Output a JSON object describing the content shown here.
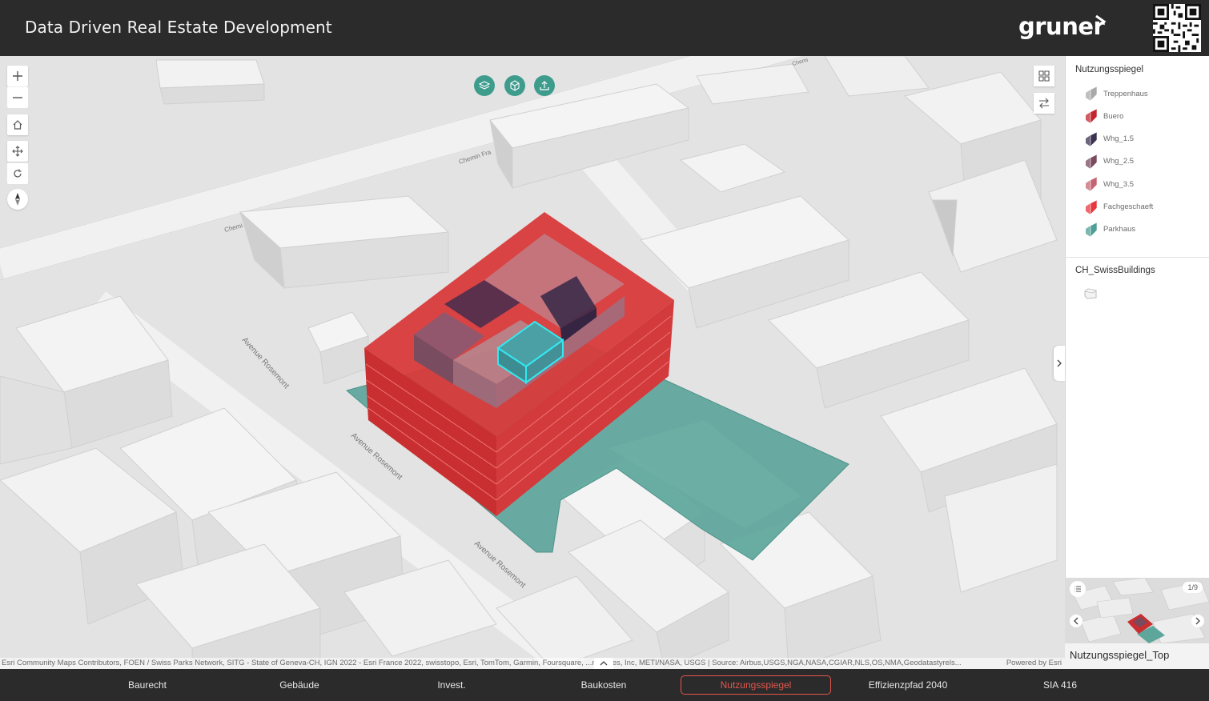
{
  "header": {
    "title": "Data Driven Real Estate Development",
    "logo_text": "gruner"
  },
  "map": {
    "street_labels": [
      "Avenue Rosemont",
      "Avenue Rosemont",
      "Avenue Rosemont",
      "Chemin Fra",
      "Chemi",
      "Chemi"
    ],
    "attribution": "Esri Community Maps Contributors, FOEN / Swiss Parks Network, SITG - State of Geneva-CH, IGN 2022 - Esri France 2022, swisstopo, Esri, TomTom, Garmin, Foursquare, ...nologies, Inc, METI/NASA, USGS | Source: Airbus,USGS,NGA,NASA,CGIAR,NLS,OS,NMA,Geodatastyrels...",
    "powered_by": "Powered by Esri"
  },
  "controls": {
    "zoom_in": "+",
    "zoom_out": "−",
    "top_icons": [
      "layers-icon",
      "basemap-icon",
      "upload-icon"
    ]
  },
  "legend": {
    "title": "Nutzungsspiegel",
    "items": [
      {
        "label": "Treppenhaus",
        "color": "#a9a9a9"
      },
      {
        "label": "Buero",
        "color": "#c1272d"
      },
      {
        "label": "Whg_1.5",
        "color": "#3c3150"
      },
      {
        "label": "Whg_2.5",
        "color": "#7a4a5e"
      },
      {
        "label": "Whg_3.5",
        "color": "#c56470"
      },
      {
        "label": "Fachgeschaeft",
        "color": "#e5383e"
      },
      {
        "label": "Parkhaus",
        "color": "#4f9f95"
      }
    ],
    "layer2_title": "CH_SwissBuildings"
  },
  "slides": {
    "counter": "1/9",
    "label": "Nutzungsspiegel_Top"
  },
  "tabs": [
    {
      "label": "Baurecht",
      "active": false
    },
    {
      "label": "Gebäude",
      "active": false
    },
    {
      "label": "Invest.",
      "active": false
    },
    {
      "label": "Baukosten",
      "active": false
    },
    {
      "label": "Nutzungsspiegel",
      "active": true
    },
    {
      "label": "Effizienzpfad 2040",
      "active": false
    },
    {
      "label": "SIA 416",
      "active": false
    }
  ],
  "colors": {
    "header_bg": "#2b2b2b",
    "accent": "#e2574c",
    "teal": "#3e9c8d"
  }
}
